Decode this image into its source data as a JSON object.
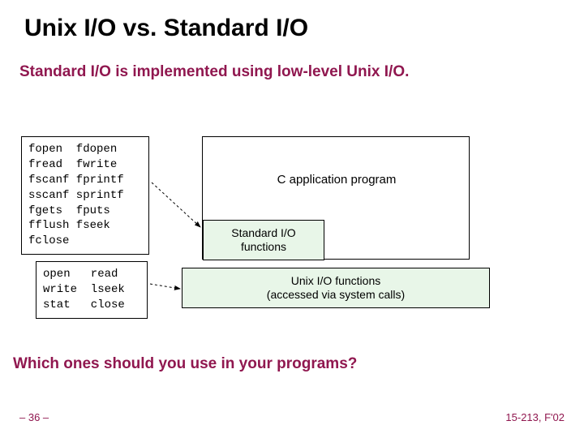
{
  "title": "Unix I/O vs. Standard I/O",
  "subtitle": "Standard I/O is implemented using low-level Unix I/O.",
  "question": "Which ones should you use in your programs?",
  "page_num": "– 36 –",
  "course": "15-213, F'02",
  "stdio_code": "fopen  fdopen\nfread  fwrite\nfscanf fprintf\nsscanf sprintf\nfgets  fputs\nfflush fseek\nfclose",
  "unixio_code": "open   read\nwrite  lseek\nstat   close",
  "diagram": {
    "app_label": "C application program",
    "stdio_label": "Standard I/O\nfunctions",
    "unixio_label": "Unix I/O functions\n(accessed via system calls)"
  }
}
